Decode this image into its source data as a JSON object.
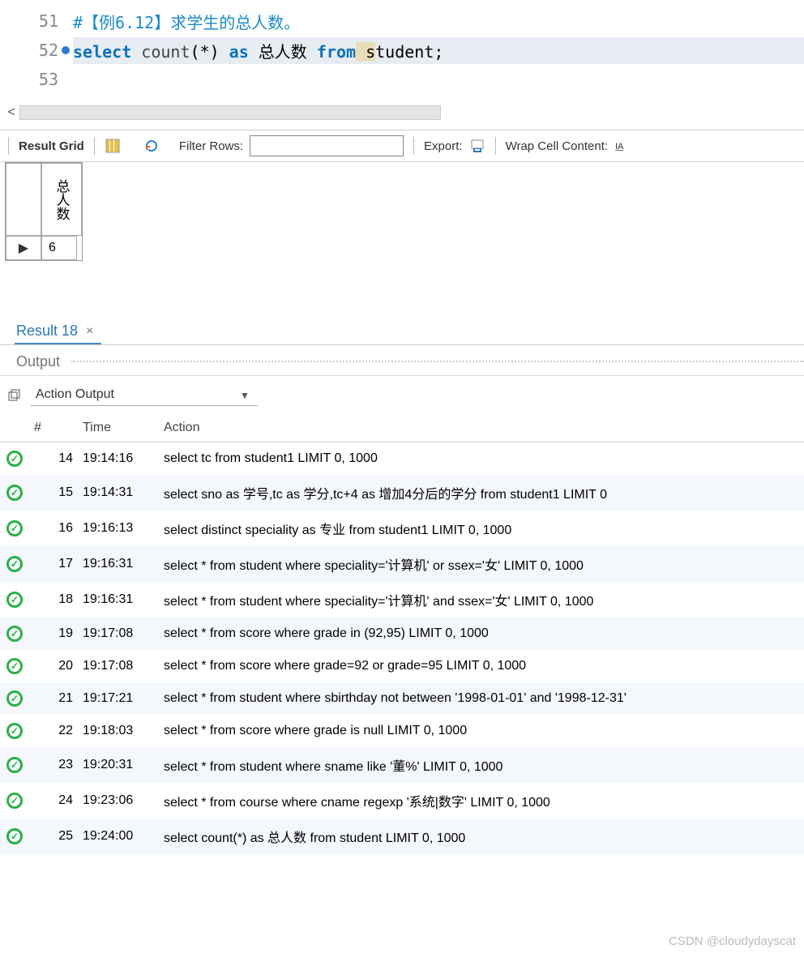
{
  "editor": {
    "lines": [
      {
        "num": "51",
        "breakpoint": false,
        "current": false
      },
      {
        "num": "52",
        "breakpoint": true,
        "current": true
      },
      {
        "num": "53",
        "breakpoint": false,
        "current": false
      }
    ],
    "line51_comment": "#【例6.12】求学生的总人数。",
    "line52": {
      "kw_select": "select",
      "func": " count",
      "args": "(*) ",
      "kw_as": "as",
      "alias": " 总人数 ",
      "kw_from": "from",
      "table_prefix": " s",
      "table_rest": "tudent;"
    }
  },
  "toolbar": {
    "result_grid": "Result Grid",
    "filter_rows": "Filter Rows:",
    "filter_value": "",
    "export": "Export:",
    "wrap": "Wrap Cell Content:"
  },
  "result": {
    "header": "总人数",
    "value": "6"
  },
  "tab": {
    "label": "Result 18",
    "close": "×"
  },
  "output": {
    "title": "Output",
    "dropdown": "Action Output",
    "columns": {
      "num": "#",
      "time": "Time",
      "action": "Action"
    },
    "rows": [
      {
        "num": "14",
        "time": "19:14:16",
        "action": "select tc from student1 LIMIT 0, 1000"
      },
      {
        "num": "15",
        "time": "19:14:31",
        "action": "select sno as 学号,tc as 学分,tc+4 as 增加4分后的学分 from student1 LIMIT 0"
      },
      {
        "num": "16",
        "time": "19:16:13",
        "action": "select distinct speciality as 专业 from student1 LIMIT 0, 1000"
      },
      {
        "num": "17",
        "time": "19:16:31",
        "action": "select * from student where speciality='计算机' or ssex='女' LIMIT 0, 1000"
      },
      {
        "num": "18",
        "time": "19:16:31",
        "action": "select * from student where speciality='计算机' and ssex='女' LIMIT 0, 1000"
      },
      {
        "num": "19",
        "time": "19:17:08",
        "action": "select * from score where grade in (92,95) LIMIT 0, 1000"
      },
      {
        "num": "20",
        "time": "19:17:08",
        "action": "select * from score where grade=92 or grade=95 LIMIT 0, 1000"
      },
      {
        "num": "21",
        "time": "19:17:21",
        "action": "select * from student where sbirthday not between '1998-01-01' and '1998-12-31'"
      },
      {
        "num": "22",
        "time": "19:18:03",
        "action": "select * from score where grade is null LIMIT 0, 1000"
      },
      {
        "num": "23",
        "time": "19:20:31",
        "action": "select * from student where sname like '董%' LIMIT 0, 1000"
      },
      {
        "num": "24",
        "time": "19:23:06",
        "action": "select * from course where cname regexp '系统|数字' LIMIT 0, 1000"
      },
      {
        "num": "25",
        "time": "19:24:00",
        "action": "select count(*) as 总人数 from student LIMIT 0, 1000"
      }
    ]
  },
  "watermark": "CSDN @cloudydayscat"
}
